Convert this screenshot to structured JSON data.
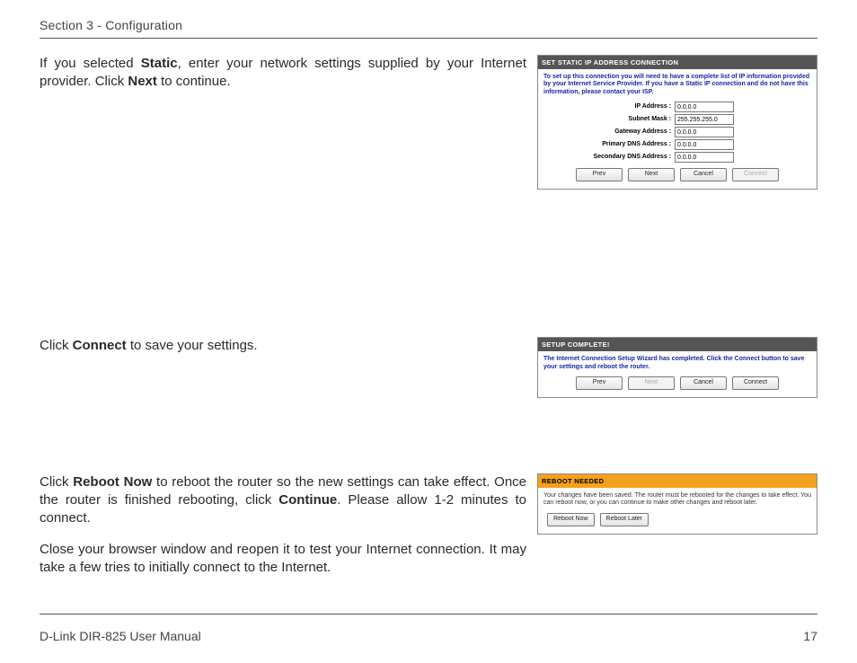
{
  "header": "Section 3 - Configuration",
  "block1": {
    "text_parts": [
      "If you selected ",
      "Static",
      ", enter your network settings supplied by your Internet provider. Click ",
      "Next",
      " to continue."
    ],
    "panel": {
      "title": "SET STATIC IP ADDRESS CONNECTION",
      "desc": "To set up this connection you will need to have a complete list of IP information provided by your Internet Service Provider. If you have a Static IP connection and do not have this information, please contact your ISP.",
      "fields": {
        "ip_label": "IP Address :",
        "ip_value": "0.0.0.0",
        "mask_label": "Subnet Mask :",
        "mask_value": "255.255.255.0",
        "gw_label": "Gateway Address :",
        "gw_value": "0.0.0.0",
        "pdns_label": "Primary DNS Address :",
        "pdns_value": "0.0.0.0",
        "sdns_label": "Secondary DNS Address :",
        "sdns_value": "0.0.0.0"
      },
      "buttons": {
        "prev": "Prev",
        "next": "Next",
        "cancel": "Cancel",
        "connect": "Connect"
      }
    }
  },
  "block2": {
    "text_parts": [
      "Click ",
      "Connect",
      " to save your settings."
    ],
    "panel": {
      "title": "SETUP COMPLETE!",
      "desc": "The Internet Connection Setup Wizard has completed. Click the Connect button to save your settings and reboot the router.",
      "buttons": {
        "prev": "Prev",
        "next": "Next",
        "cancel": "Cancel",
        "connect": "Connect"
      }
    }
  },
  "block3": {
    "para1_parts": [
      "Click ",
      "Reboot Now",
      " to reboot the router so the new settings can take effect. Once the router is finished rebooting, click ",
      "Continue",
      ". Please allow 1-2 minutes to connect."
    ],
    "para2": "Close your browser window and reopen it to test your Internet connection. It may take a few tries to initially connect to the Internet.",
    "panel": {
      "title": "REBOOT NEEDED",
      "desc": "Your changes have been saved. The router must be rebooted for the changes to take effect. You can reboot now, or you can continue to make other changes and reboot later.",
      "buttons": {
        "reboot_now": "Reboot Now",
        "reboot_later": "Reboot Later"
      }
    }
  },
  "footer": {
    "left": "D-Link DIR-825 User Manual",
    "right": "17"
  }
}
